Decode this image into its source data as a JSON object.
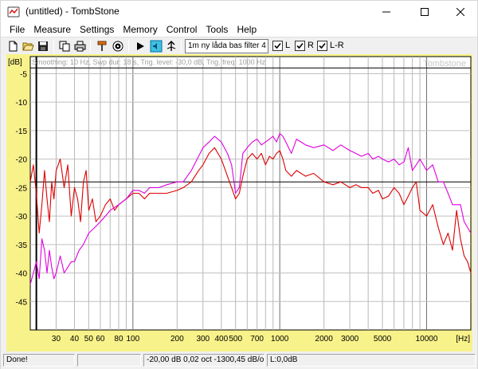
{
  "window": {
    "title": "(untitled) - TombStone"
  },
  "menu": {
    "items": [
      "File",
      "Measure",
      "Settings",
      "Memory",
      "Control",
      "Tools",
      "Help"
    ]
  },
  "toolbar": {
    "measurement_name": "1m ny låda bas filter 4",
    "checkboxes": [
      {
        "label": "L",
        "checked": true
      },
      {
        "label": "R",
        "checked": true
      },
      {
        "label": "L-R",
        "checked": true
      }
    ]
  },
  "plot": {
    "info_line": "Smoothing: 10 Hz, Swp dur: 18 s, Trig. level: -30,0 dB, Trig. freq: 1000 Hz",
    "watermark": "Tombstone",
    "background_color": "#f8f28a",
    "plot_bg_color": "#ffffff",
    "y_unit_label": "[dB]",
    "x_unit_label": "[Hz]"
  },
  "chart_data": {
    "type": "line",
    "xscale": "log",
    "xlim": [
      20,
      20000
    ],
    "ylim": [
      -50,
      -2
    ],
    "xlabel": "[Hz]",
    "ylabel": "[dB]",
    "y_ticks": [
      -5,
      -10,
      -15,
      -20,
      -25,
      -30,
      -35,
      -40,
      -45
    ],
    "y_tick_labels": [
      "-5",
      "-10",
      "-15",
      "-20",
      "-25",
      "-30",
      "-35",
      "-40",
      "-45"
    ],
    "x_ticks": [
      30,
      40,
      50,
      60,
      80,
      100,
      200,
      300,
      400,
      500,
      700,
      1000,
      2000,
      3000,
      5000,
      10000
    ],
    "x_tick_labels": [
      "30",
      "40",
      "50",
      "60",
      "80",
      "100",
      "200",
      "300",
      "400",
      "500",
      "700",
      "1000",
      "2000",
      "3000",
      "5000",
      "10000"
    ],
    "grid": true,
    "reference_lines": [
      {
        "axis": "y",
        "value": -4
      },
      {
        "axis": "y",
        "value": -24
      },
      {
        "axis": "x",
        "value": 22
      }
    ],
    "series": [
      {
        "color": "#dd0000",
        "x": [
          20,
          21,
          22,
          23,
          24,
          25,
          26,
          27,
          28,
          29,
          30,
          32,
          34,
          36,
          38,
          40,
          42,
          44,
          46,
          48,
          50,
          53,
          56,
          60,
          65,
          70,
          75,
          80,
          90,
          100,
          110,
          120,
          130,
          150,
          170,
          200,
          220,
          250,
          280,
          300,
          330,
          360,
          400,
          440,
          470,
          500,
          530,
          560,
          600,
          650,
          700,
          750,
          800,
          850,
          900,
          950,
          1000,
          1050,
          1100,
          1200,
          1300,
          1500,
          1700,
          2000,
          2300,
          2600,
          3000,
          3300,
          3600,
          4000,
          4300,
          4700,
          5000,
          5500,
          6000,
          6500,
          7000,
          7500,
          8000,
          8500,
          9000,
          10000,
          11000,
          12000,
          13000,
          14000,
          15000,
          16000,
          17000,
          18000,
          19000,
          20000
        ],
        "y": [
          -24,
          -21,
          -26,
          -33,
          -28,
          -22,
          -27,
          -31,
          -24,
          -27,
          -22,
          -20,
          -25,
          -21,
          -30,
          -25,
          -27,
          -31,
          -24,
          -22,
          -29,
          -27,
          -31,
          -30,
          -28,
          -27,
          -29,
          -28,
          -27,
          -26,
          -26,
          -27,
          -26,
          -26,
          -26,
          -25.5,
          -25,
          -24,
          -22,
          -21,
          -19,
          -18,
          -20,
          -23,
          -25,
          -27,
          -26,
          -23,
          -20,
          -19,
          -20,
          -19,
          -21,
          -19.5,
          -20,
          -19,
          -18.5,
          -20,
          -22,
          -23,
          -22,
          -23,
          -22.5,
          -24,
          -24.5,
          -24,
          -25,
          -24.5,
          -25,
          -25,
          -26,
          -25.5,
          -27,
          -26.5,
          -25,
          -26,
          -28,
          -26.5,
          -25,
          -24,
          -29,
          -30,
          -28,
          -32,
          -35,
          -33,
          -36,
          -29,
          -34,
          -37,
          -38,
          -40
        ]
      },
      {
        "color": "#e000e0",
        "x": [
          20,
          21,
          22,
          23,
          24,
          25,
          26,
          27,
          28,
          29,
          30,
          32,
          34,
          36,
          38,
          40,
          43,
          46,
          50,
          55,
          60,
          65,
          70,
          80,
          90,
          100,
          110,
          120,
          130,
          150,
          170,
          200,
          220,
          250,
          280,
          300,
          330,
          360,
          400,
          440,
          470,
          500,
          530,
          560,
          600,
          650,
          700,
          750,
          800,
          850,
          900,
          950,
          1000,
          1050,
          1100,
          1200,
          1300,
          1500,
          1700,
          2000,
          2300,
          2600,
          3000,
          3300,
          3600,
          4000,
          4300,
          4700,
          5000,
          5500,
          6000,
          6500,
          7000,
          7500,
          8000,
          8500,
          9000,
          10000,
          11000,
          12000,
          13000,
          14000,
          15000,
          16000,
          17000,
          18000,
          19000,
          20000
        ],
        "y": [
          -42,
          -40,
          -38,
          -41,
          -34,
          -36,
          -40,
          -36,
          -39,
          -41,
          -40,
          -37,
          -40,
          -39,
          -38,
          -38,
          -36,
          -35,
          -33,
          -32,
          -31,
          -30,
          -29,
          -28,
          -27,
          -25.5,
          -25.5,
          -26,
          -25,
          -25,
          -24.5,
          -24,
          -24,
          -22,
          -19.5,
          -18,
          -17,
          -16,
          -17,
          -19,
          -21,
          -26,
          -25,
          -19,
          -18,
          -17,
          -16.5,
          -17.5,
          -17,
          -16.5,
          -16,
          -17,
          -15.5,
          -16,
          -17,
          -19,
          -16.5,
          -17.5,
          -18,
          -17.5,
          -18.5,
          -17.5,
          -18.5,
          -19,
          -19.5,
          -19,
          -20,
          -19.5,
          -20,
          -20.5,
          -20,
          -21,
          -20.5,
          -18,
          -22,
          -21,
          -20,
          -22,
          -21,
          -24,
          -24,
          -26,
          -28,
          -28,
          -28,
          -31,
          -32,
          -33
        ]
      }
    ]
  },
  "status": {
    "message": "Done!",
    "empty": "",
    "cursor": "-20,00 dB 0,02 oct -1300,45 dB/oc",
    "level": "L:0,0dB"
  }
}
